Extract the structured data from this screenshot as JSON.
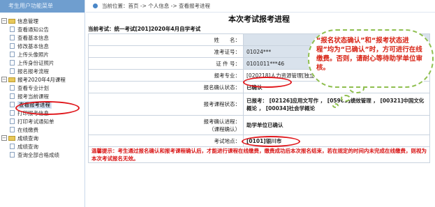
{
  "sidebar": {
    "top_text": "考生用户功能菜单",
    "groups": [
      {
        "label": "信息管理",
        "items": [
          "查看通知公告",
          "查看基本信息",
          "修改基本信息",
          "上传头像照片",
          "上传身份证照片",
          "报名报考流程"
        ]
      },
      {
        "label": "报考2020年4月课程",
        "items": [
          "查看专业计划",
          "报考当前课程",
          "查看报考进程",
          "打印报考信息",
          "打印考试通知单",
          "在线缴费"
        ]
      },
      {
        "label": "成绩查询",
        "items": [
          "成绩查询",
          "查询全部合格成绩"
        ]
      }
    ]
  },
  "breadcrumb": "当前位置：首页 -> 个人信息 -> 查看报考进程",
  "page": {
    "title": "本次考试报考进程",
    "current_exam": "当前考试：统一考试[201]2020年4月自学考试"
  },
  "rows": {
    "name_label": "姓　　名：",
    "name_value": "",
    "ticket_label": "准考证号：",
    "ticket_value": "01024***",
    "id_label": "证 件 号：",
    "id_value": "0101011***46",
    "major_label": "报考专业：",
    "major_value": "[020218]人力资源管理[独立本科段]",
    "status_label": "报名确认状态：",
    "status_value": "已确认",
    "course_label": "报考课程状态：",
    "course_value": "已报考： [02126]应用文写作 ， [05963]绩效管理 ， [00321]中国文化概论 ， [00034]社会学概论",
    "progress_label": "报考确认进程：",
    "progress_label2": "（课程确认）",
    "progress_value": "助学单位已确认",
    "site_label": "考试地点：",
    "site_value": "[0101]银川市"
  },
  "warning": "温馨提示：考生通过报名确认和报考课程确认后，才能进行课程在线缴费，缴费成功后本次报名结束，若在规定的时间内未完成在线缴费，则视为本次考试报名无效。",
  "callout": "“报名状态确认”和“报考状态进程”均为“已确认”时，方可进行在线缴费。否则，请耐心等待助学单位审核。"
}
